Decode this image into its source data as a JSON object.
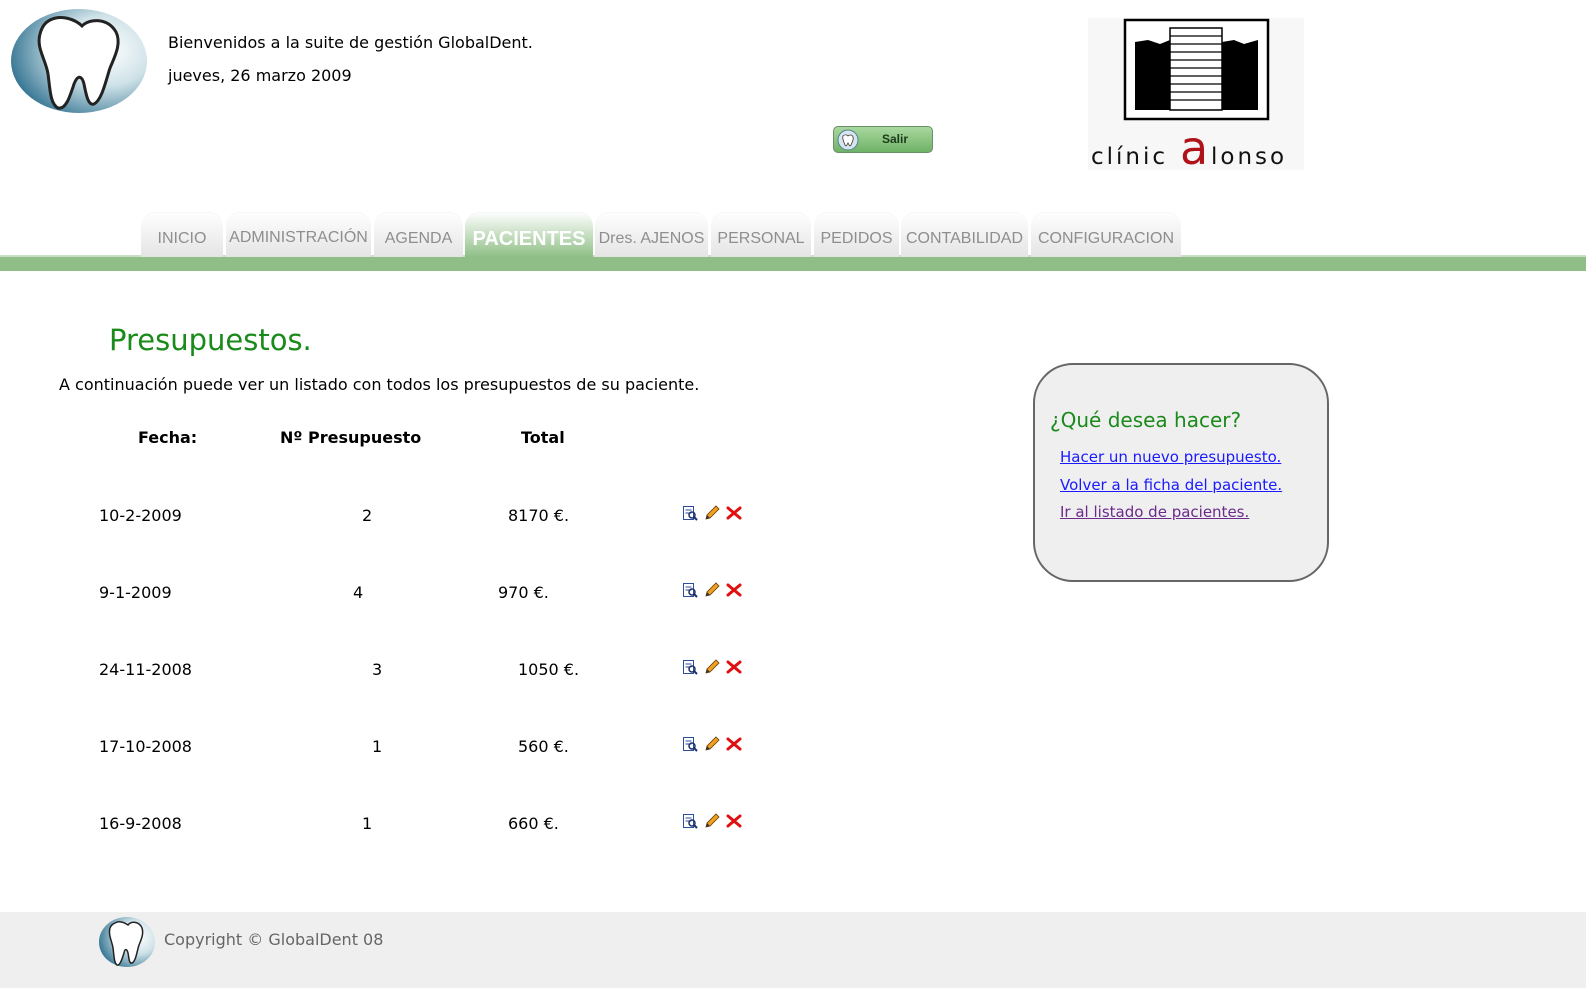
{
  "header": {
    "welcome": "Bienvenidos a la suite de gestión GlobalDent.",
    "date": "jueves, 26 marzo 2009",
    "logout_label": "Salir",
    "clinic_logo_text_a": "clínic",
    "clinic_logo_text_b": "a",
    "clinic_logo_text_c": "lonso"
  },
  "nav": {
    "tabs": [
      {
        "label": "INICIO"
      },
      {
        "label": "ADMINISTRACIÓN"
      },
      {
        "label": "AGENDA"
      },
      {
        "label": "PACIENTES"
      },
      {
        "label": "Dres. AJENOS"
      },
      {
        "label": "PERSONAL"
      },
      {
        "label": "PEDIDOS"
      },
      {
        "label": "CONTABILIDAD"
      },
      {
        "label": "CONFIGURACION"
      }
    ],
    "active_tab": "PACIENTES"
  },
  "main": {
    "title": "Presupuestos.",
    "intro": "A continuación puede ver un listado con todos los presupuestos de su paciente.",
    "columns": [
      "Fecha:",
      "Nº Presupuesto",
      "Total"
    ],
    "rows": [
      {
        "fecha": "10-2-2009",
        "numero": "2",
        "total": "8170 €."
      },
      {
        "fecha": "9-1-2009",
        "numero": "4",
        "total": "970 €."
      },
      {
        "fecha": "24-11-2008",
        "numero": "3",
        "total": "1050 €."
      },
      {
        "fecha": "17-10-2008",
        "numero": "1",
        "total": "560 €."
      },
      {
        "fecha": "16-9-2008",
        "numero": "1",
        "total": "660 €."
      }
    ],
    "row_icons": [
      "view-icon",
      "edit-pencil-icon",
      "delete-x-icon"
    ]
  },
  "side": {
    "title": "¿Qué desea hacer?",
    "links": [
      {
        "label": "Hacer un nuevo presupuesto."
      },
      {
        "label": "Volver a la ficha del paciente."
      },
      {
        "label": "Ir al listado de pacientes."
      }
    ]
  },
  "footer": {
    "copyright": "Copyright © GlobalDent 08"
  },
  "colors": {
    "accent_green": "#1a8a1a",
    "nav_green": "#8fbf86",
    "link_blue": "#1a1aff",
    "link_visited": "#6b2a8c"
  }
}
